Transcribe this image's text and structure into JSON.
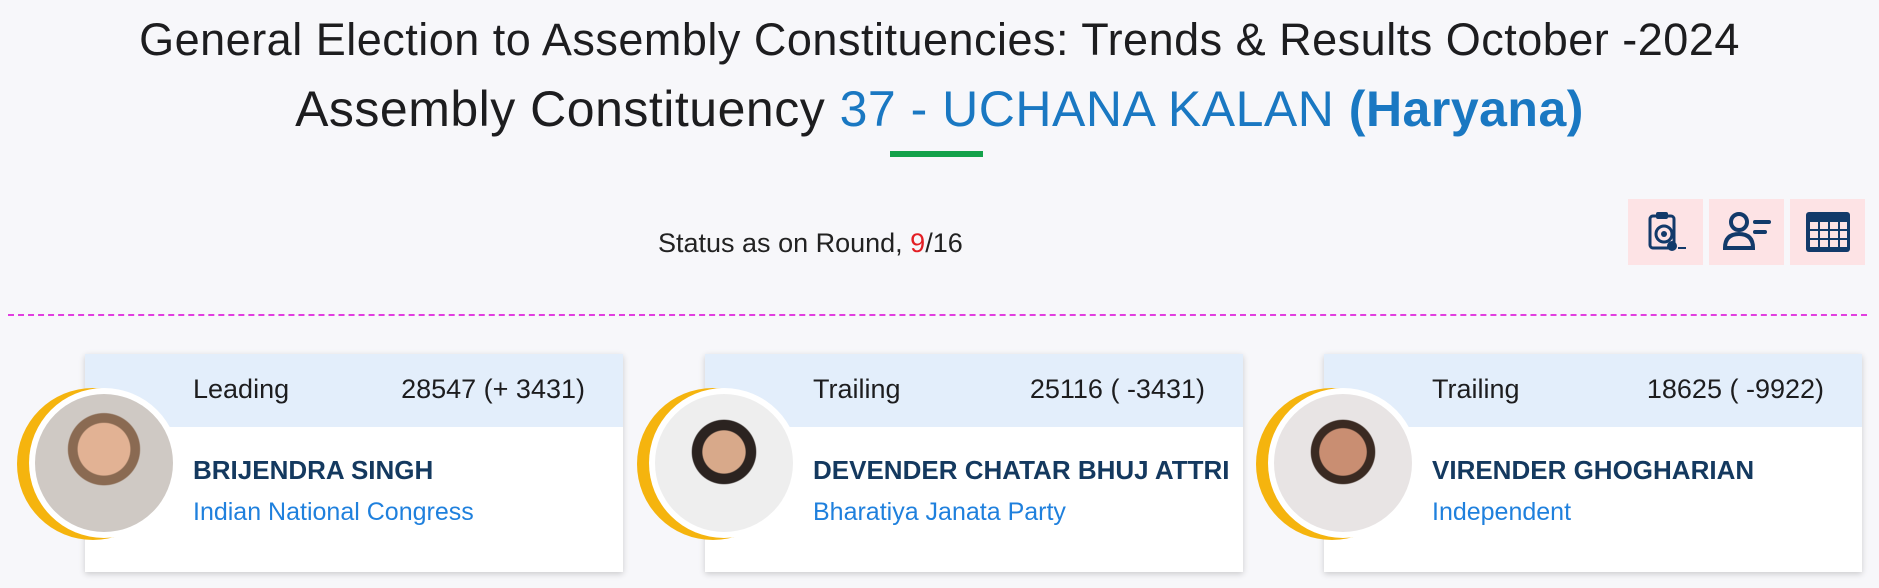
{
  "header": {
    "title_line1": "General Election to Assembly Constituencies: Trends & Results October -2024",
    "title_line2_prefix": "Assembly Constituency ",
    "constituency": "37 - UCHANA KALAN",
    "state": "(Haryana)"
  },
  "status": {
    "label": "Status as on Round, ",
    "round_current": "9",
    "round_total": "/16"
  },
  "toolbar": {
    "icons": [
      "result-report-icon",
      "candidate-list-icon",
      "table-grid-icon"
    ]
  },
  "colors": {
    "accent": "#1a78c2",
    "underline": "#14a24a",
    "round_highlight": "#e31e24",
    "card_header": "#e3eefb",
    "avatar_ring": "#f5b40e",
    "divider": "#e23fe0"
  },
  "candidates": [
    {
      "status": "Leading",
      "votes": "28547 (+ 3431)",
      "name": "BRIJENDRA SINGH",
      "party": "Indian National Congress"
    },
    {
      "status": "Trailing",
      "votes": "25116 ( -3431)",
      "name": "DEVENDER CHATAR BHUJ ATTRI",
      "party": "Bharatiya Janata Party"
    },
    {
      "status": "Trailing",
      "votes": "18625 ( -9922)",
      "name": "VIRENDER GHOGHARIAN",
      "party": "Independent"
    }
  ]
}
